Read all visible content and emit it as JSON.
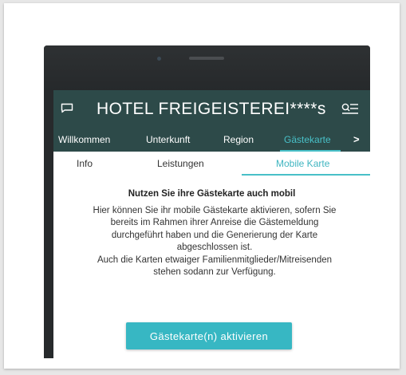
{
  "app": {
    "title": "HOTEL FREIGEISTEREI****s",
    "icons": {
      "left": "chat-icon",
      "right": "menu-search-icon"
    }
  },
  "nav": {
    "tabs": [
      "Willkommen",
      "Unterkunft",
      "Region",
      "Gästekarte"
    ],
    "active_index": 3,
    "next_label": ">"
  },
  "subnav": {
    "tabs": [
      "Info",
      "Leistungen",
      "Mobile Karte"
    ],
    "active_index": 2
  },
  "content": {
    "heading": "Nutzen Sie ihre Gästekarte auch mobil",
    "body": [
      "Hier können Sie ihr mobile Gästekarte aktivieren, sofern Sie",
      "bereits im Rahmen ihrer Anreise die Gästemeldung",
      "durchgeführt haben und die Generierung der Karte",
      "abgeschlossen ist.",
      "Auch die Karten etwaiger Familienmitglieder/Mitreisenden",
      "stehen sodann zur Verfügung."
    ],
    "button_label": "Gästekarte(n) aktivieren"
  },
  "colors": {
    "appbar": "#2d4a49",
    "accent": "#48c0c8",
    "button": "#37b7c3",
    "phone_frame": "#272a2c"
  }
}
